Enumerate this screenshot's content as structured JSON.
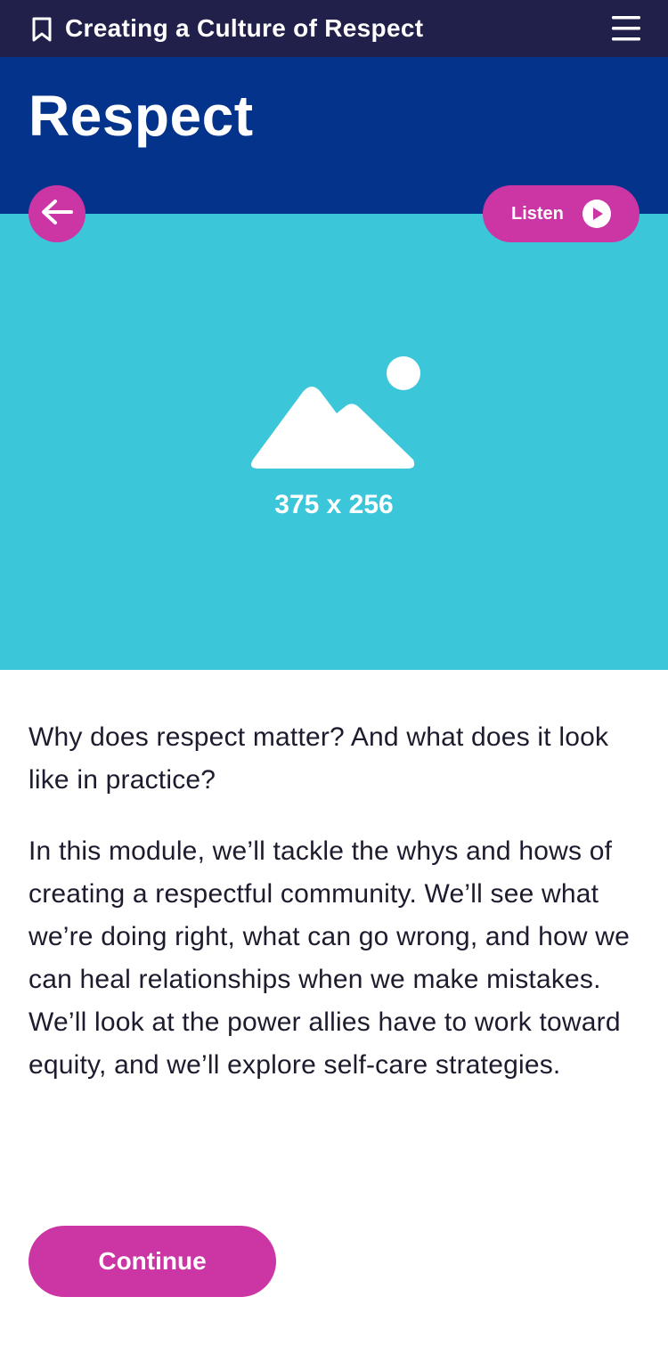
{
  "topbar": {
    "title": "Creating a Culture of Respect",
    "bookmark_icon": "bookmark-icon",
    "menu_icon": "hamburger-menu-icon"
  },
  "header": {
    "title": "Respect"
  },
  "controls": {
    "back_icon": "arrow-left-icon",
    "listen_label": "Listen",
    "play_icon": "play-icon"
  },
  "hero": {
    "placeholder_icon": "image-placeholder-icon",
    "placeholder_label": "375 x 256"
  },
  "content": {
    "paragraphs": [
      "Why does respect matter? And what does it look like in practice?",
      "In this module, we’ll tackle the whys and hows of creating a respectful community. We’ll see what we’re doing right, what can go wrong, and how we can heal relationships when we make mistakes. We’ll look at the power allies have to work toward equity, and we’ll explore self-care strategies."
    ]
  },
  "footer": {
    "continue_label": "Continue"
  },
  "colors": {
    "topbar": "#21204a",
    "header": "#04338b",
    "hero": "#3cc6da",
    "accent": "#cc35a4",
    "text": "#1c1c2e"
  }
}
